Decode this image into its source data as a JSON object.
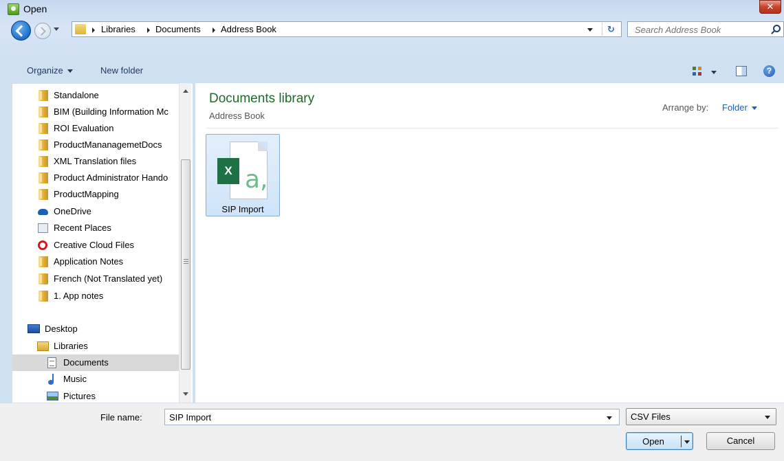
{
  "window": {
    "title": "Open",
    "close_glyph": "✕"
  },
  "address": {
    "breadcrumbs": [
      "Libraries",
      "Documents",
      "Address Book"
    ],
    "refresh_glyph": "↻",
    "search_placeholder": "Search Address Book"
  },
  "toolbar": {
    "organize_label": "Organize",
    "new_folder_label": "New folder",
    "help_glyph": "?"
  },
  "nav": {
    "items": [
      {
        "label": "Standalone",
        "icon": "folder-icon"
      },
      {
        "label": "BIM (Building Information Mc",
        "icon": "folder-icon"
      },
      {
        "label": "ROI Evaluation",
        "icon": "folder-icon"
      },
      {
        "label": "ProductMananagemetDocs",
        "icon": "folder-icon"
      },
      {
        "label": "XML Translation files",
        "icon": "folder-icon"
      },
      {
        "label": "Product Administrator Hando",
        "icon": "folder-icon"
      },
      {
        "label": "ProductMapping",
        "icon": "folder-icon"
      },
      {
        "label": "OneDrive",
        "icon": "onedrive-icon"
      },
      {
        "label": "Recent Places",
        "icon": "recent-places-icon"
      },
      {
        "label": "Creative Cloud Files",
        "icon": "creative-cloud-icon"
      },
      {
        "label": "Application Notes",
        "icon": "folder-icon"
      },
      {
        "label": "French (Not Translated yet)",
        "icon": "folder-icon"
      },
      {
        "label": "1. App notes",
        "icon": "folder-icon"
      }
    ],
    "desktop_label": "Desktop",
    "libraries_label": "Libraries",
    "documents_label": "Documents",
    "music_label": "Music",
    "pictures_label": "Pictures",
    "selected": "Documents"
  },
  "content": {
    "library_title": "Documents library",
    "library_subtitle": "Address Book",
    "arrange_label": "Arrange by:",
    "arrange_value": "Folder",
    "files": [
      {
        "name": "SIP Import",
        "badge": "X",
        "glyph": "a,"
      }
    ]
  },
  "footer": {
    "file_name_label": "File name:",
    "file_name_value": "SIP Import",
    "file_type_value": "CSV Files",
    "open_label": "Open",
    "cancel_label": "Cancel"
  },
  "colors": {
    "library_title": "#1e6b2a",
    "link_blue": "#1d5fb4",
    "excel_green": "#1e7145"
  }
}
